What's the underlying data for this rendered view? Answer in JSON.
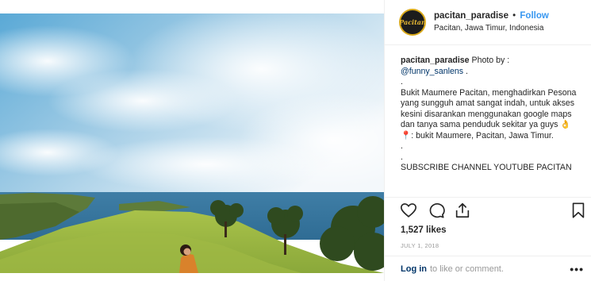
{
  "header": {
    "username": "pacitan_paradise",
    "separator": "•",
    "follow_label": "Follow",
    "location": "Pacitan, Jawa Timur, Indonesia",
    "avatar_text": "Pacitan"
  },
  "caption": {
    "username": "pacitan_paradise",
    "lead": " Photo by :",
    "mention": "@funny_sanlens",
    "mention_suffix": " .",
    "body": ".\nBukit Maumere Pacitan, menghadirkan Pesona yang sungguh amat sangat indah, untuk akses kesini disarankan menggunakan google maps dan tanya sama penduduk sekitar ya guys 👌📍: bukit Maumere, Pacitan, Jawa Timur.\n.\n.\nSUBSCRIBE CHANNEL YOUTUBE PACITAN"
  },
  "actions": {
    "like_icon": "heart-icon",
    "comment_icon": "comment-icon",
    "share_icon": "share-icon",
    "save_icon": "bookmark-icon"
  },
  "likes": "1,527 likes",
  "date": "JULY 1, 2018",
  "comment_bar": {
    "login_label": "Log in",
    "prompt": "to like or comment.",
    "more_label": "•••"
  },
  "colors": {
    "follow": "#3897f0",
    "link": "#003569",
    "meta": "#999999"
  }
}
